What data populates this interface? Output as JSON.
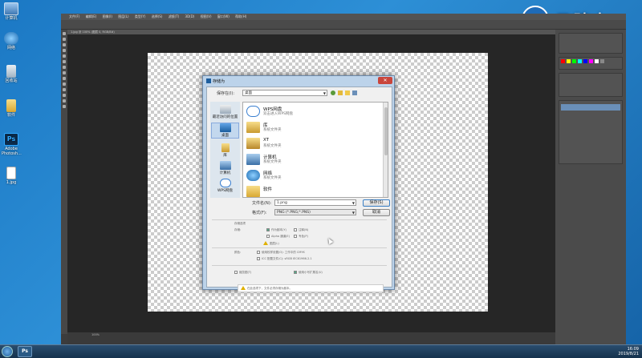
{
  "desktop": {
    "icons": [
      {
        "label": "计算机",
        "icon": "computer-icon"
      },
      {
        "label": "网络",
        "icon": "network-icon"
      },
      {
        "label": "回收站",
        "icon": "recycle-bin-icon"
      },
      {
        "label": "软件",
        "icon": "folder-icon"
      },
      {
        "label": "Adobe Photosh...",
        "icon": "photoshop-icon"
      },
      {
        "label": "1.jpg",
        "icon": "image-file-icon"
      }
    ]
  },
  "watermark": {
    "text": "云骑士"
  },
  "photoshop": {
    "menu": [
      "文件(F)",
      "编辑(E)",
      "图像(I)",
      "图层(L)",
      "类型(Y)",
      "选择(S)",
      "滤镜(T)",
      "3D(D)",
      "视图(V)",
      "窗口(W)",
      "帮助(H)"
    ],
    "doc_tab": "1.jpg @ 100% (图层 0, RGB/8#)",
    "status": "100%",
    "colors": {
      "bg": "#3c3c3c",
      "workspace": "#262626"
    }
  },
  "dialog": {
    "title": "存储为",
    "close_label": "✕",
    "save_in_label": "保存在(I):",
    "save_in_value": "桌面",
    "places": [
      {
        "label": "最近访问的位置",
        "icon": "recent-places-icon"
      },
      {
        "label": "桌面",
        "icon": "desktop-icon"
      },
      {
        "label": "库",
        "icon": "library-icon"
      },
      {
        "label": "计算机",
        "icon": "computer-icon"
      },
      {
        "label": "WPS网盘",
        "icon": "wps-cloud-icon"
      }
    ],
    "files": [
      {
        "name": "WPS网盘",
        "desc": "双击进入WPS网盘",
        "icon": "wps-cloud-icon"
      },
      {
        "name": "库",
        "desc": "系统文件夹",
        "icon": "library-icon"
      },
      {
        "name": "XT",
        "desc": "系统文件夹",
        "icon": "user-folder-icon"
      },
      {
        "name": "计算机",
        "desc": "系统文件夹",
        "icon": "computer-icon"
      },
      {
        "name": "网络",
        "desc": "系统文件夹",
        "icon": "network-icon"
      },
      {
        "name": "软件",
        "desc": "",
        "icon": "folder-icon"
      }
    ],
    "filename_label": "文件名(N):",
    "filename_value": "1.png",
    "format_label": "格式(F):",
    "format_value": "PNG (*.PNG;*.PNS)",
    "save_button": "保存(S)",
    "cancel_button": "取消",
    "options_title": "存储选项",
    "save_label": "存储:",
    "opt_copy": "作为副本(Y)",
    "opt_notes": "注释(N)",
    "opt_alpha": "Alpha 通道(E)",
    "opt_spot": "专色(P)",
    "opt_layers": "图层(L)",
    "color_label": "颜色:",
    "opt_proof": "使用校样设置(O): 工作中的 CMYK",
    "opt_icc": "ICC 配置文件(C): sRGB IEC61966-2.1",
    "opt_thumb": "缩览图(T)",
    "opt_ext": "使用小写扩展名(U)",
    "warn_text": "在此选项下，文件必须存储为副本。"
  },
  "taskbar": {
    "time": "16:09",
    "date": "2019/8/21"
  }
}
